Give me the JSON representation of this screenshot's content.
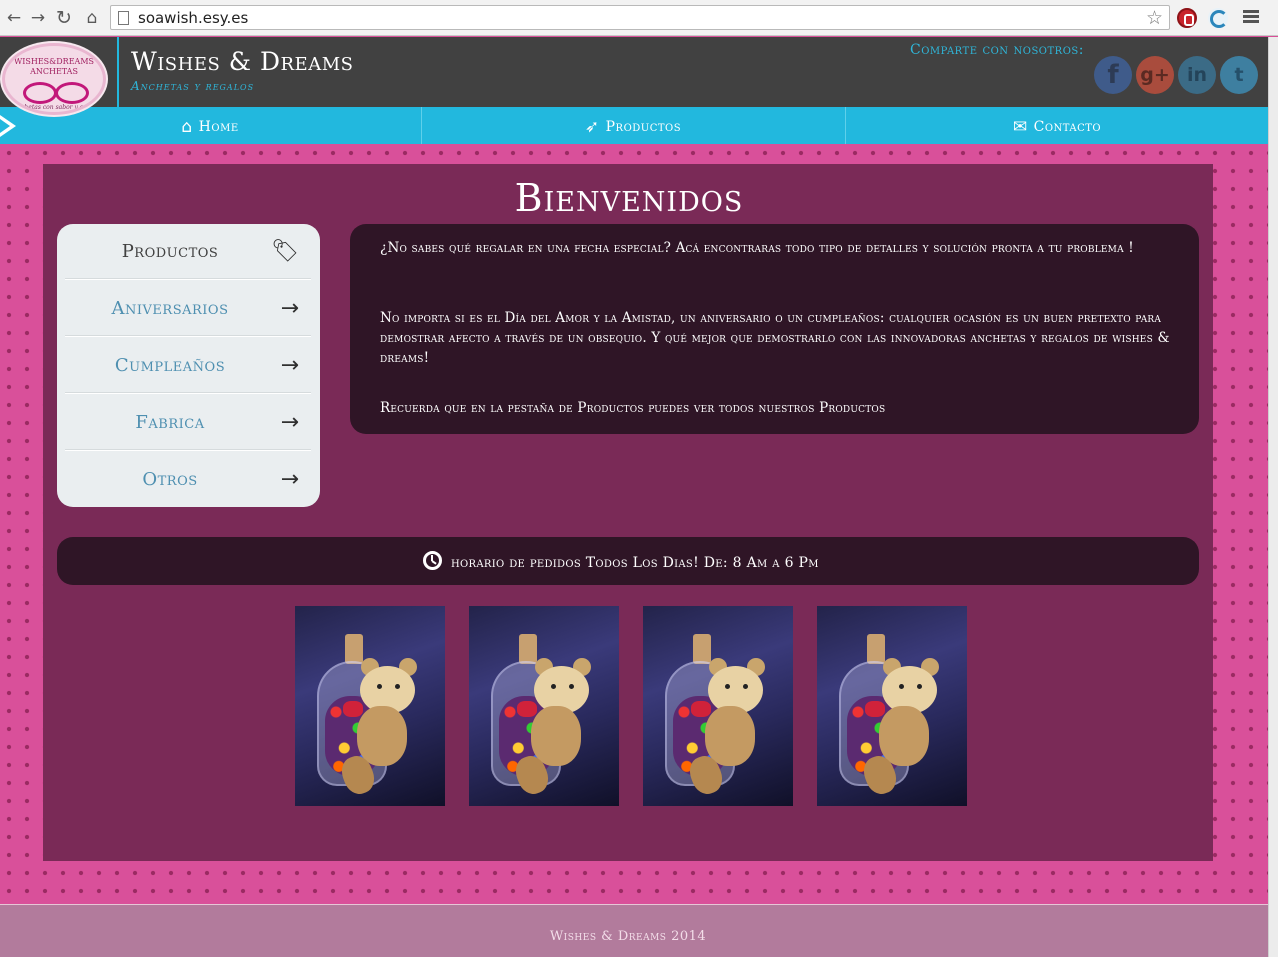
{
  "browser": {
    "url": "soawish.esy.es",
    "back_icon": "back-arrow-icon",
    "forward_icon": "forward-arrow-icon",
    "reload_icon": "reload-icon",
    "home_icon": "home-icon"
  },
  "header": {
    "logo_line1": "WISHES&DREAMS",
    "logo_line2": "ANCHETAS",
    "logo_line3": "Anchetas con sabor y color",
    "brand": "Wishes & Dreams",
    "tagline": "Anchetas y regalos",
    "share_label": "Comparte con nosotros:",
    "social": [
      {
        "label": "f",
        "icon": "facebook-icon",
        "color": "#3f5b8a"
      },
      {
        "label": "g+",
        "icon": "google-plus-icon",
        "color": "#a94c3d"
      },
      {
        "label": "in",
        "icon": "linkedin-icon",
        "color": "#3b6b86"
      },
      {
        "label": "t",
        "icon": "twitter-icon",
        "color": "#3e7fa0"
      }
    ]
  },
  "nav": {
    "items": [
      {
        "label": "Home",
        "icon": "home-icon"
      },
      {
        "label": "Productos",
        "icon": "rocket-icon"
      },
      {
        "label": "Contacto",
        "icon": "envelope-icon"
      }
    ]
  },
  "main": {
    "title": "Bienvenidos",
    "sidemenu": [
      {
        "label": "Productos",
        "icon": "tags-icon"
      },
      {
        "label": "Aniversarios",
        "icon": "arrow-right-icon"
      },
      {
        "label": "Cumpleaños",
        "icon": "arrow-right-icon"
      },
      {
        "label": "Fabrica",
        "icon": "arrow-right-icon"
      },
      {
        "label": "Otros",
        "icon": "arrow-right-icon"
      }
    ],
    "paragraphs": [
      "¿No sabes qué regalar en una fecha especial? Acá encontraras todo tipo de detalles y solución pronta a tu problema !",
      "No importa si es el Día del Amor y la Amistad, un aniversario o un cumpleaños: cualquier ocasión es un buen pretexto para demostrar afecto a través de un obsequio. Y qué mejor que demostrarlo con las innovadoras anchetas y regalos de wishes & dreams!",
      "Recuerda que en la pestaña de Productos puedes ver todos nuestros Productos"
    ],
    "schedule": "horario de pedidos Todos Los Dias! De: 8 Am a 6 Pm",
    "photos_count": 4
  },
  "footer": {
    "text": "Wishes & Dreams 2014"
  },
  "colors": {
    "accent": "#22b8de",
    "header_bg": "#414141",
    "pattern_bg": "#d9509a",
    "panel_bg": "#7a2a57",
    "dark_box": "#2f1526"
  }
}
